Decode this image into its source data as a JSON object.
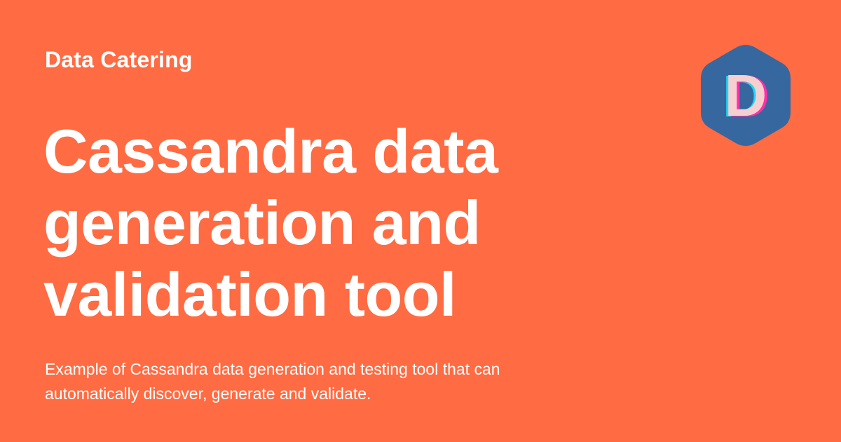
{
  "site": {
    "name": "Data Catering"
  },
  "hero": {
    "title_lines": [
      "Cassandra data",
      "generation and",
      "validation tool"
    ],
    "description": "Example of Cassandra data generation and testing tool that can automatically discover, generate and validate."
  },
  "logo": {
    "letter": "D",
    "icon": "hexagon-d-logo-icon"
  },
  "colors": {
    "background": "#ff6b42",
    "text": "#ffffff",
    "logo_hexagon": "#36679f",
    "logo_letter": "#f6cfd1",
    "logo_shadow_cyan": "#22d7ee",
    "logo_shadow_magenta": "#ff2ea6"
  }
}
